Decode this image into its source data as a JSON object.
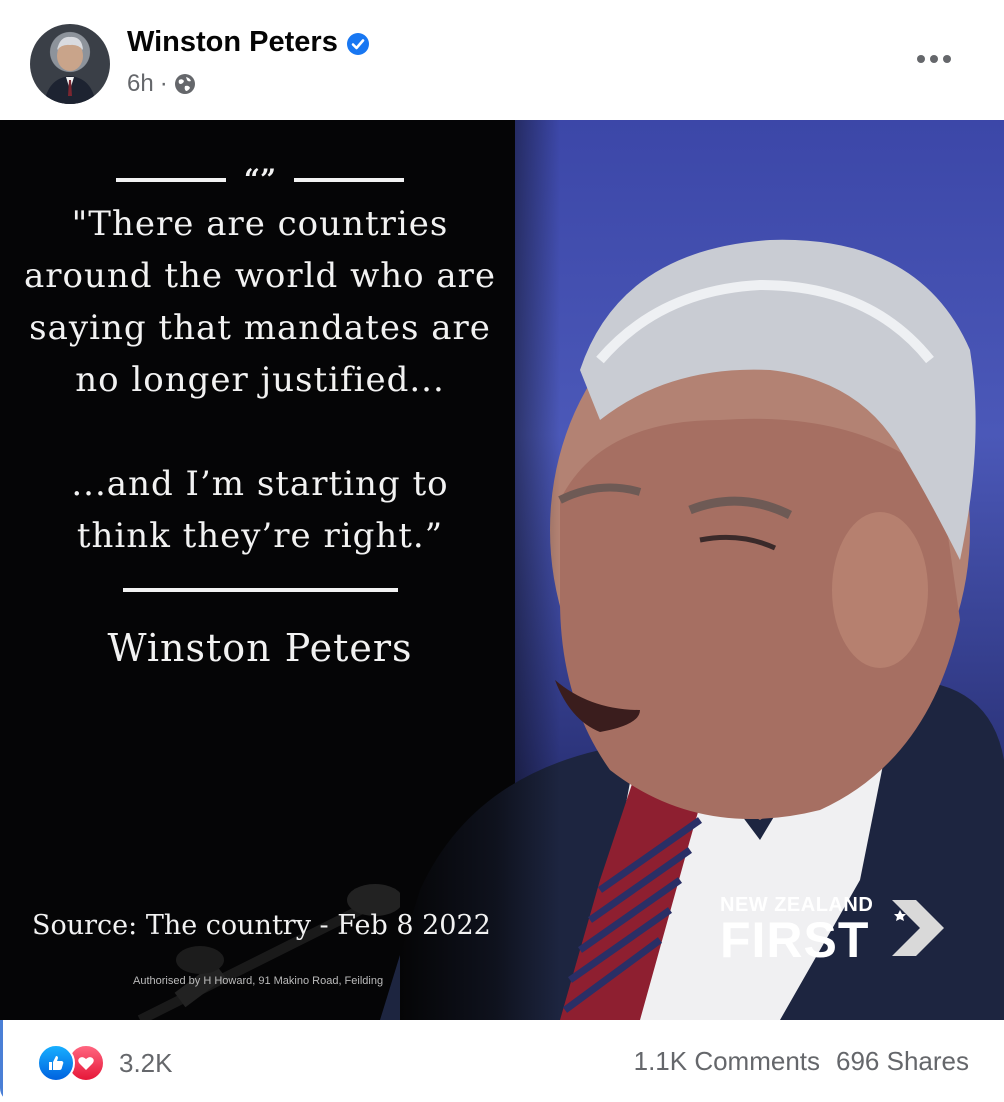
{
  "post": {
    "author": "Winston Peters",
    "time": "6h",
    "separator": "·",
    "audience_icon": "globe-icon",
    "verified_icon": "verified-badge-icon",
    "more_icon": "more-options-icon"
  },
  "image": {
    "quote_mark": "“”",
    "quote_lines_1": "\"There are countries around the world who are saying that mandates are no longer justified...",
    "quote_lines_2": "...and I’m starting to think they’re right.”",
    "quote_author": "Winston Peters",
    "source": "Source: The country - Feb 8 2022",
    "authorised": "Authorised by H Howard, 91 Makino Road, Feilding",
    "logo_top": "NEW ZEALAND",
    "logo_bottom": "FIRST"
  },
  "footer": {
    "reaction_icons": [
      "like-icon",
      "love-icon"
    ],
    "reaction_count": "3.2K",
    "comments": "1.1K Comments",
    "shares": "696 Shares"
  },
  "colors": {
    "brand_blue": "#1877f2",
    "meta_gray": "#65676b",
    "like_blue": "#0a7cff",
    "love_red": "#f33e58"
  }
}
